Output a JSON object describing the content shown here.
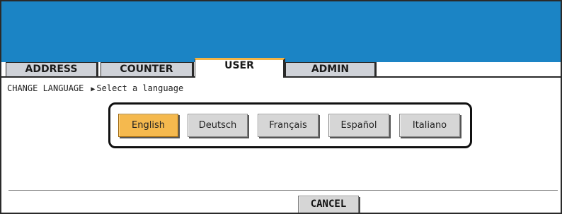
{
  "tabs": {
    "address": "ADDRESS",
    "counter": "COUNTER",
    "user": "USER",
    "admin": "ADMIN",
    "active": "USER"
  },
  "screen": {
    "title": "CHANGE LANGUAGE",
    "instruction": "Select a language"
  },
  "languages": {
    "english": "English",
    "deutsch": "Deutsch",
    "francais": "Français",
    "espanol": "Español",
    "italiano": "Italiano",
    "selected": "English"
  },
  "footer": {
    "cancel_label": "CANCEL"
  },
  "colors": {
    "header": "#1b84c5",
    "selected": "#f5b94e",
    "active_tab_accent": "#f4b445"
  }
}
